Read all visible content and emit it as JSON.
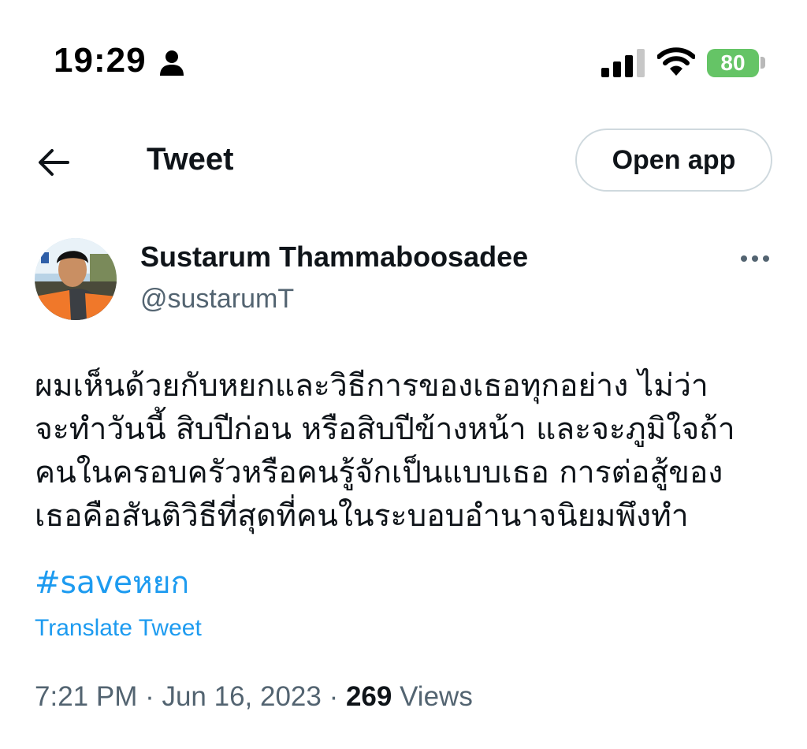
{
  "status_bar": {
    "time": "19:29",
    "battery": "80",
    "icons": [
      "person-icon",
      "signal-icon",
      "wifi-icon",
      "battery-icon"
    ],
    "battery_color": "#65c466"
  },
  "header": {
    "back_icon": "back-arrow-icon",
    "title": "Tweet",
    "open_app_label": "Open app"
  },
  "tweet": {
    "author": {
      "display_name": "Sustarum Thammaboosadee",
      "handle": "@sustarumT",
      "more_icon": "more-icon"
    },
    "text_lines": [
      "ผมเห็นด้วยกับหยกและวิธีการของเธอทุกอย่าง ไม่ว่า",
      "จะทำวันนี้ สิบปีก่อน หรือสิบปีข้างหน้า และจะภูมิใจถ้า",
      "คนในครอบครัวหรือคนรู้จักเป็นแบบเธอ การต่อสู้ของ",
      "เธอคือสันติวิธีที่สุดที่คนในระบอบอำนาจนิยมพึงทำ"
    ],
    "hashtag": "#saveหยก",
    "translate_label": "Translate Tweet",
    "timestamp": "7:21 PM · Jun 16, 2023 · ",
    "views_count": "269",
    "views_label": " Views"
  },
  "colors": {
    "link": "#1d9bf0",
    "secondary_text": "#536471",
    "primary_text": "#0f1419",
    "border": "#cfd9de"
  }
}
